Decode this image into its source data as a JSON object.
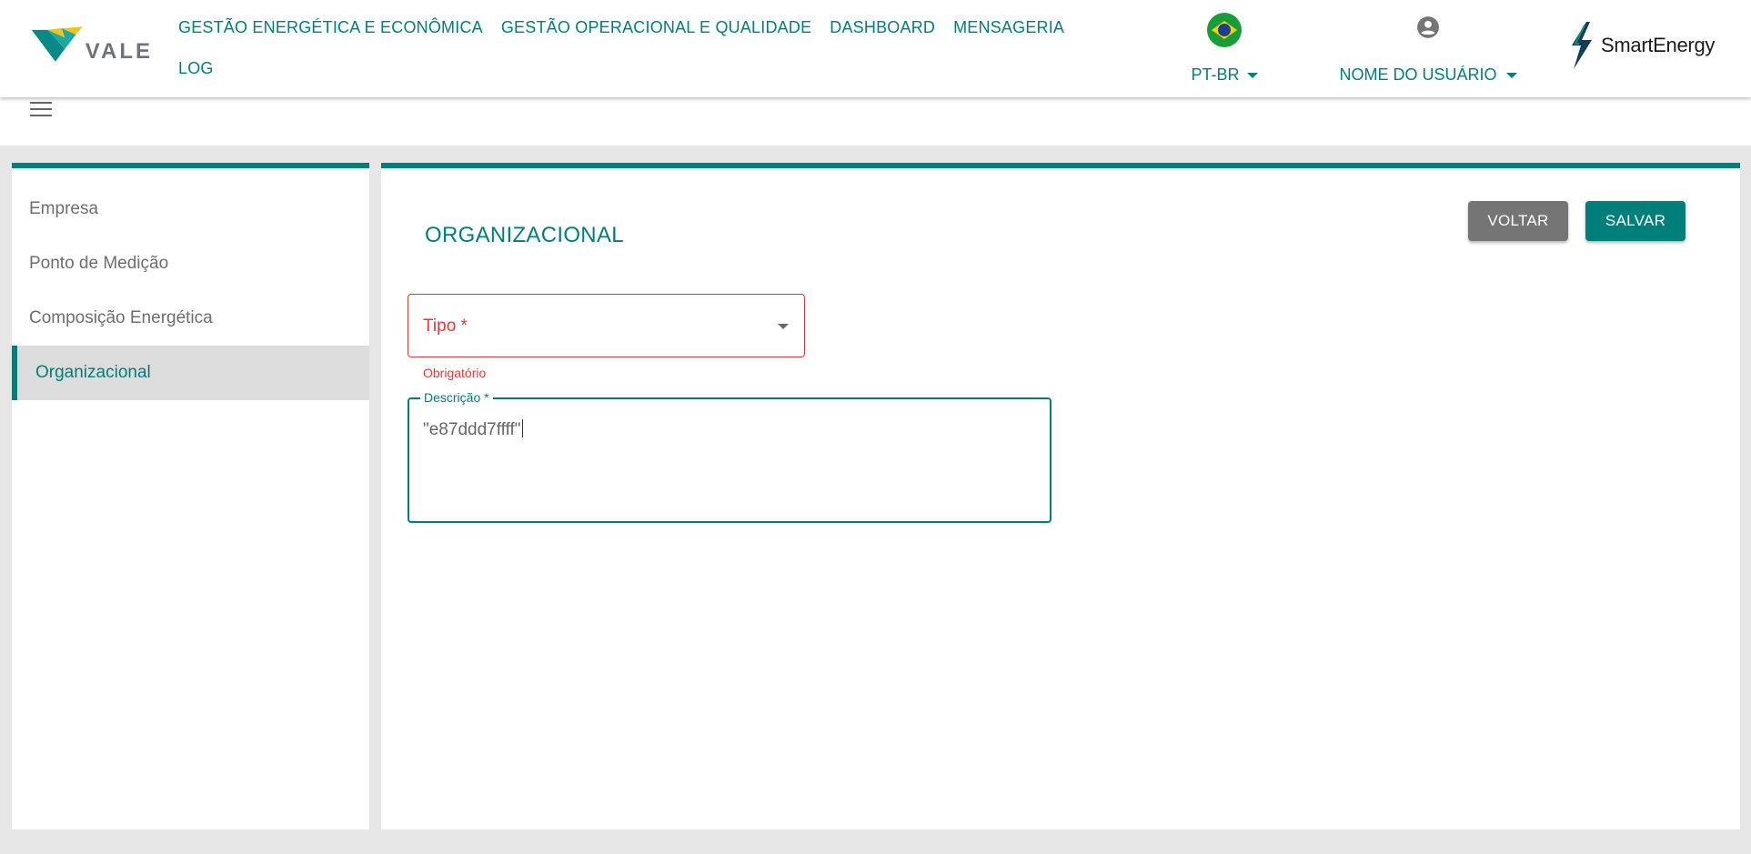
{
  "header": {
    "logo_text": "VALE",
    "nav": [
      "GESTÃO ENERGÉTICA E ECONÔMICA",
      "GESTÃO OPERACIONAL E QUALIDADE",
      "DASHBOARD",
      "MENSAGERIA",
      "LOG"
    ],
    "language_label": "PT-BR",
    "user_label": "NOME DO USUÁRIO",
    "brand_text": "SmartEnergy"
  },
  "sidebar": {
    "items": [
      {
        "label": "Empresa",
        "active": false
      },
      {
        "label": "Ponto de Medição",
        "active": false
      },
      {
        "label": "Composição Energética",
        "active": false
      },
      {
        "label": "Organizacional",
        "active": true
      }
    ]
  },
  "main": {
    "title": "ORGANIZACIONAL",
    "back_label": "VOLTAR",
    "save_label": "SALVAR",
    "tipo_label": "Tipo *",
    "tipo_helper": "Obrigatório",
    "descricao_label": "Descrição *",
    "descricao_value": "\"e87ddd7ffff\""
  },
  "colors": {
    "primary": "#007e7a",
    "error": "#e53935",
    "secondary_button": "#757575",
    "background": "#e6e6e6"
  }
}
